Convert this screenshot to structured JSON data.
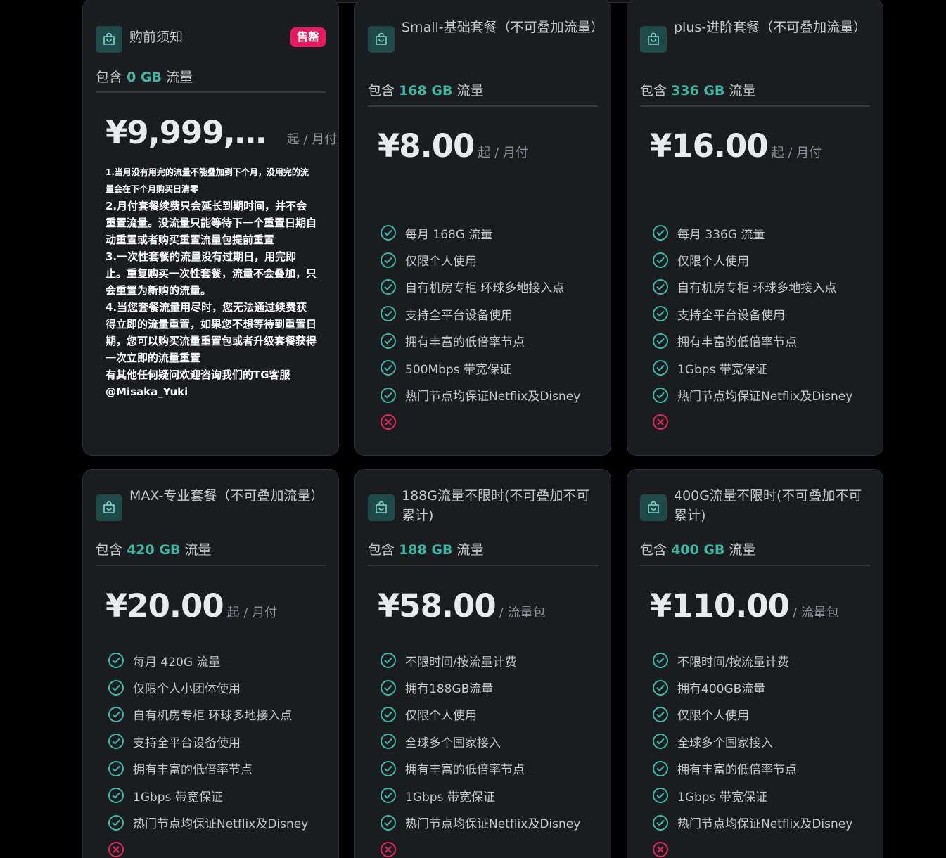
{
  "colors": {
    "accent": "#3fb7a7",
    "badge": "#e8185f",
    "cross": "#e3285e",
    "card_bg": "#1b1c20"
  },
  "cards": [
    {
      "title": "购前须知",
      "badge": "售罄",
      "include_prefix": "包含",
      "gb": "0 GB",
      "include_suffix": "流量",
      "price": "¥9,999,…",
      "unit": "起 / 月付",
      "notice": [
        "1.当月没有用完的流量不能叠加到下个月，没用完的流量会在下个月购买日清零",
        "2.月付套餐续费只会延长到期时间，并不会重置流量。没流量只能等待下一个重置日期自动重置或者购买重置流量包提前重置",
        "3.一次性套餐的流量没有过期日，用完即止。重复购买一次性套餐，流量不会叠加，只会重置为新购的流量。",
        "4.当您套餐流量用尽时，您无法通过续费获得立即的流量重置，如果您不想等待到重置日期，您可以购买流量重置包或者升级套餐获得一次立即的流量重置",
        "有其他任何疑问欢迎咨询我们的TG客服",
        "@Misaka_Yuki"
      ]
    },
    {
      "title": "Small-基础套餐（不可叠加流量）",
      "include_prefix": "包含",
      "gb": "168 GB",
      "include_suffix": "流量",
      "price": "¥8.00",
      "unit": "起 / 月付",
      "features": [
        "每月 168G 流量",
        "仅限个人使用",
        "自有机房专柜 环球多地接入点",
        "支持全平台设备使用",
        "拥有丰富的低倍率节点",
        "500Mbps 带宽保证",
        "热门节点均保证Netflix及Disney"
      ]
    },
    {
      "title": "plus-进阶套餐（不可叠加流量）",
      "include_prefix": "包含",
      "gb": "336 GB",
      "include_suffix": "流量",
      "price": "¥16.00",
      "unit": "起 / 月付",
      "features": [
        "每月 336G 流量",
        "仅限个人使用",
        "自有机房专柜 环球多地接入点",
        "支持全平台设备使用",
        "拥有丰富的低倍率节点",
        "1Gbps 带宽保证",
        "热门节点均保证Netflix及Disney"
      ]
    },
    {
      "title": "MAX-专业套餐（不可叠加流量）",
      "include_prefix": "包含",
      "gb": "420 GB",
      "include_suffix": "流量",
      "price": "¥20.00",
      "unit": "起 / 月付",
      "features": [
        "每月 420G 流量",
        "仅限个人小团体使用",
        "自有机房专柜 环球多地接入点",
        "支持全平台设备使用",
        "拥有丰富的低倍率节点",
        "1Gbps 带宽保证",
        "热门节点均保证Netflix及Disney"
      ]
    },
    {
      "title": "188G流量不限时(不可叠加不可累计)",
      "include_prefix": "包含",
      "gb": "188 GB",
      "include_suffix": "流量",
      "price": "¥58.00",
      "unit": "/ 流量包",
      "features": [
        "不限时间/按流量计费",
        "拥有188GB流量",
        "仅限个人使用",
        "全球多个国家接入",
        "拥有丰富的低倍率节点",
        "1Gbps 带宽保证",
        "热门节点均保证Netflix及Disney"
      ]
    },
    {
      "title": "400G流量不限时(不可叠加不可累计)",
      "include_prefix": "包含",
      "gb": "400 GB",
      "include_suffix": "流量",
      "price": "¥110.00",
      "unit": "/ 流量包",
      "features": [
        "不限时间/按流量计费",
        "拥有400GB流量",
        "仅限个人使用",
        "全球多个国家接入",
        "拥有丰富的低倍率节点",
        "1Gbps 带宽保证",
        "热门节点均保证Netflix及Disney"
      ]
    }
  ]
}
